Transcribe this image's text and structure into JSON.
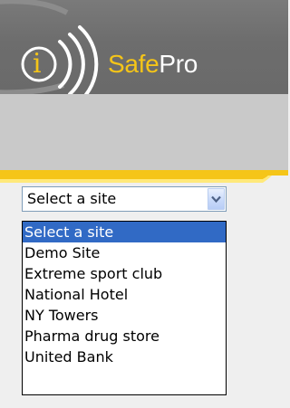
{
  "brand": {
    "logo_letter": "i",
    "name_part1": "Safe",
    "name_part2": "Pro",
    "colors": {
      "accent_yellow": "#f5c518",
      "header_gray": "#6e6e6e",
      "nav_gray": "#c9c9c9",
      "selection_blue": "#316ac5"
    }
  },
  "site_select": {
    "selected_value": "Select a site",
    "expanded": true,
    "arrow_icon": "chevron-down-icon",
    "options": [
      "Select a site",
      "Demo Site",
      "Extreme sport club",
      "National Hotel",
      "NY Towers",
      "Pharma drug store",
      "United Bank"
    ],
    "highlighted_index": 0
  }
}
